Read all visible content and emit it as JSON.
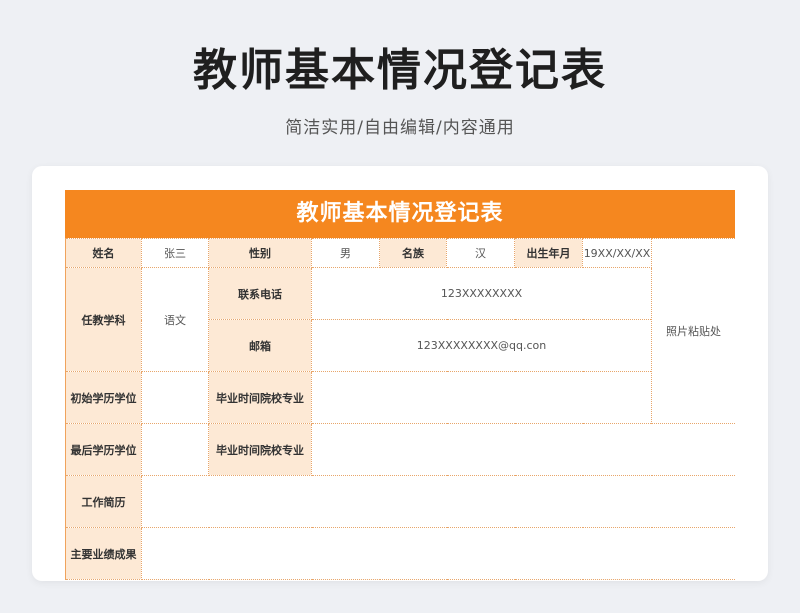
{
  "page": {
    "title": "教师基本情况登记表",
    "subtitle": "简洁实用/自由编辑/内容通用"
  },
  "form": {
    "header": "教师基本情况登记表",
    "name_label": "姓名",
    "name_value": "张三",
    "gender_label": "性别",
    "gender_value": "男",
    "ethnicity_label": "名族",
    "ethnicity_value": "汉",
    "birth_label": "出生年月",
    "birth_value": "19XX/XX/XX",
    "photo_label": "照片粘贴处",
    "subject_label": "任教学科",
    "subject_value": "语文",
    "phone_label": "联系电话",
    "phone_value": "123XXXXXXXX",
    "email_label": "邮箱",
    "email_value": "123XXXXXXXX@qq.con",
    "initial_degree_label": "初始学历学位",
    "initial_degree_value": "",
    "initial_grad_label": "毕业时间院校专业",
    "initial_grad_value": "",
    "initial_extra_value": "",
    "final_degree_label": "最后学历学位",
    "final_degree_value": "",
    "final_grad_label": "毕业时间院校专业",
    "final_grad_value": "",
    "work_label": "工作简历",
    "work_value": "",
    "achievements_label": "主要业绩成果",
    "achievements_value": ""
  }
}
